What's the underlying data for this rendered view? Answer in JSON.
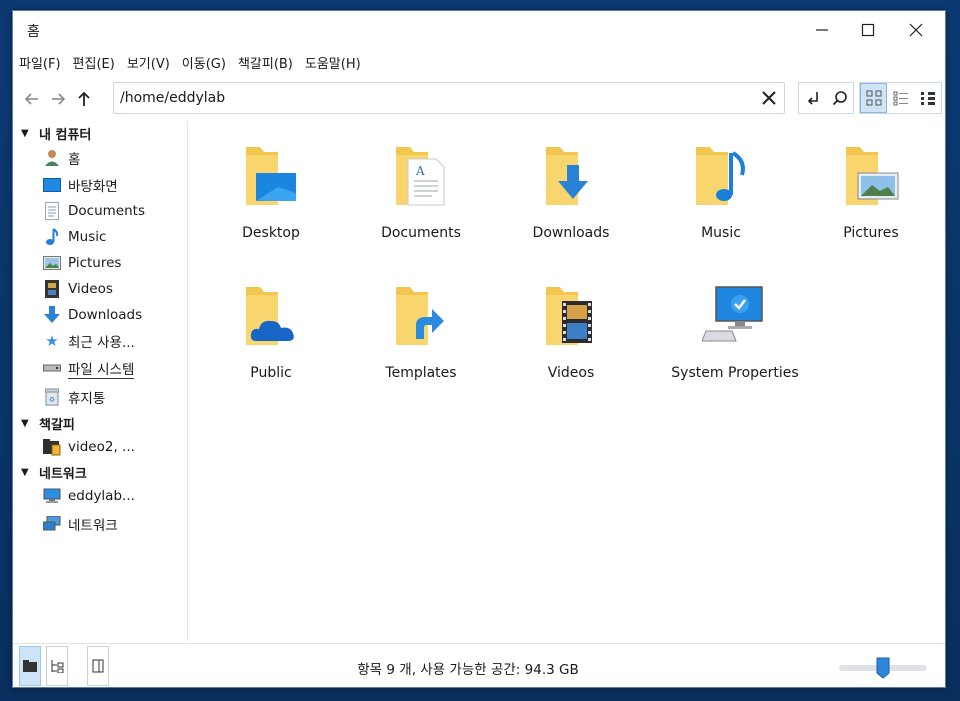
{
  "window": {
    "title": "홈",
    "minimize_icon": "minimize-icon",
    "maximize_icon": "maximize-icon",
    "close_icon": "close-icon"
  },
  "menu": [
    {
      "label": "파일(F)"
    },
    {
      "label": "편집(E)"
    },
    {
      "label": "보기(V)"
    },
    {
      "label": "이동(G)"
    },
    {
      "label": "책갈피(B)"
    },
    {
      "label": "도움말(H)"
    }
  ],
  "toolbar": {
    "back_icon": "arrow-left-icon",
    "forward_icon": "arrow-right-icon",
    "up_icon": "arrow-up-icon",
    "address": "/home/eddylab",
    "clear_icon": "clear-icon",
    "go_icon": "return-arrow-icon",
    "search_icon": "search-icon",
    "view_modes": [
      "icon-view",
      "compact-view",
      "detail-view"
    ],
    "active_view": "icon-view"
  },
  "sidebar": {
    "sections": [
      {
        "label": "내 컴퓨터",
        "items": [
          {
            "label": "홈",
            "icon": "home-user-icon"
          },
          {
            "label": "바탕화면",
            "icon": "desktop-icon"
          },
          {
            "label": "Documents",
            "icon": "document-icon"
          },
          {
            "label": "Music",
            "icon": "music-note-icon"
          },
          {
            "label": "Pictures",
            "icon": "picture-icon"
          },
          {
            "label": "Videos",
            "icon": "film-icon"
          },
          {
            "label": "Downloads",
            "icon": "download-arrow-icon"
          },
          {
            "label": "최근 사용...",
            "icon": "star-icon"
          },
          {
            "label": "파일 시스템",
            "icon": "drive-icon"
          },
          {
            "label": "휴지통",
            "icon": "trash-icon"
          }
        ]
      },
      {
        "label": "책갈피",
        "items": [
          {
            "label": "video2, ...",
            "icon": "bookmark-folder-icon"
          }
        ]
      },
      {
        "label": "네트워크",
        "items": [
          {
            "label": "eddylab...",
            "icon": "computer-icon"
          },
          {
            "label": "네트워크",
            "icon": "network-icon"
          }
        ]
      }
    ]
  },
  "files": [
    {
      "label": "Desktop",
      "icon": "folder-desktop-icon"
    },
    {
      "label": "Documents",
      "icon": "folder-documents-icon"
    },
    {
      "label": "Downloads",
      "icon": "folder-downloads-icon"
    },
    {
      "label": "Music",
      "icon": "folder-music-icon"
    },
    {
      "label": "Pictures",
      "icon": "folder-pictures-icon"
    },
    {
      "label": "Public",
      "icon": "folder-public-icon"
    },
    {
      "label": "Templates",
      "icon": "folder-templates-icon"
    },
    {
      "label": "Videos",
      "icon": "folder-videos-icon"
    },
    {
      "label": "System Properties",
      "icon": "system-properties-icon"
    }
  ],
  "statusbar": {
    "text": "항목 9 개, 사용 가능한 공간: 94.3 GB",
    "zoom_level": 0.5
  },
  "colors": {
    "folder": "#f3c64f",
    "accent": "#2d8ee0",
    "selection": "#cde4f7"
  }
}
